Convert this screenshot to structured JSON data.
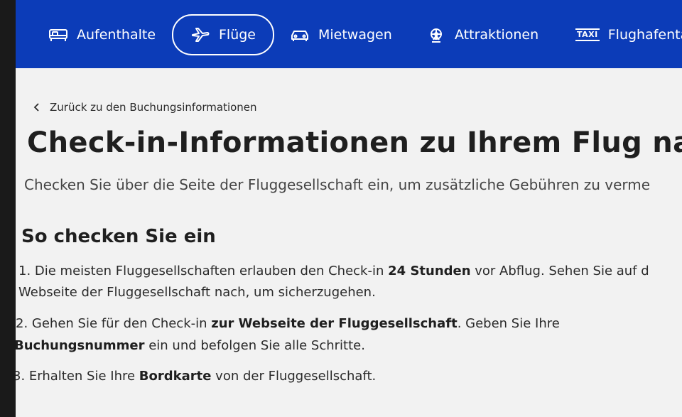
{
  "nav": {
    "items": [
      {
        "label": "Aufenthalte",
        "icon": "bed-icon"
      },
      {
        "label": "Flüge",
        "icon": "plane-icon",
        "active": true
      },
      {
        "label": "Mietwagen",
        "icon": "car-icon"
      },
      {
        "label": "Attraktionen",
        "icon": "attractions-icon"
      },
      {
        "label": "Flughafenta",
        "icon": "taxi-icon",
        "badge": "TAXI"
      }
    ]
  },
  "back_link": "Zurück zu den Buchungsinformationen",
  "title": "Check-in-Informationen zu Ihrem Flug na",
  "subtitle": "Checken Sie über die Seite der Fluggesellschaft ein, um zusätzliche Gebühren zu verme",
  "section_title": "So checken Sie ein",
  "steps": {
    "s1": {
      "a": "1. Die meisten Fluggesellschaften erlauben den Check-in ",
      "b": "24 Stunden",
      "c": " vor Abflug. Sehen Sie auf d",
      "d": "Webseite der Fluggesellschaft nach, um sicherzugehen."
    },
    "s2": {
      "a": "2. Gehen Sie für den Check-in ",
      "b": "zur Webseite der Fluggesellschaft",
      "c": ". Geben Sie Ihre",
      "d": "Buchungsnummer",
      "e": " ein und befolgen Sie alle Schritte."
    },
    "s3": {
      "a": "3. Erhalten Sie Ihre ",
      "b": "Bordkarte",
      "c": " von der Fluggesellschaft."
    }
  },
  "colors": {
    "nav_bg": "#0c3cb8",
    "page_bg": "#f2f2f2",
    "text": "#1f1f1f"
  }
}
